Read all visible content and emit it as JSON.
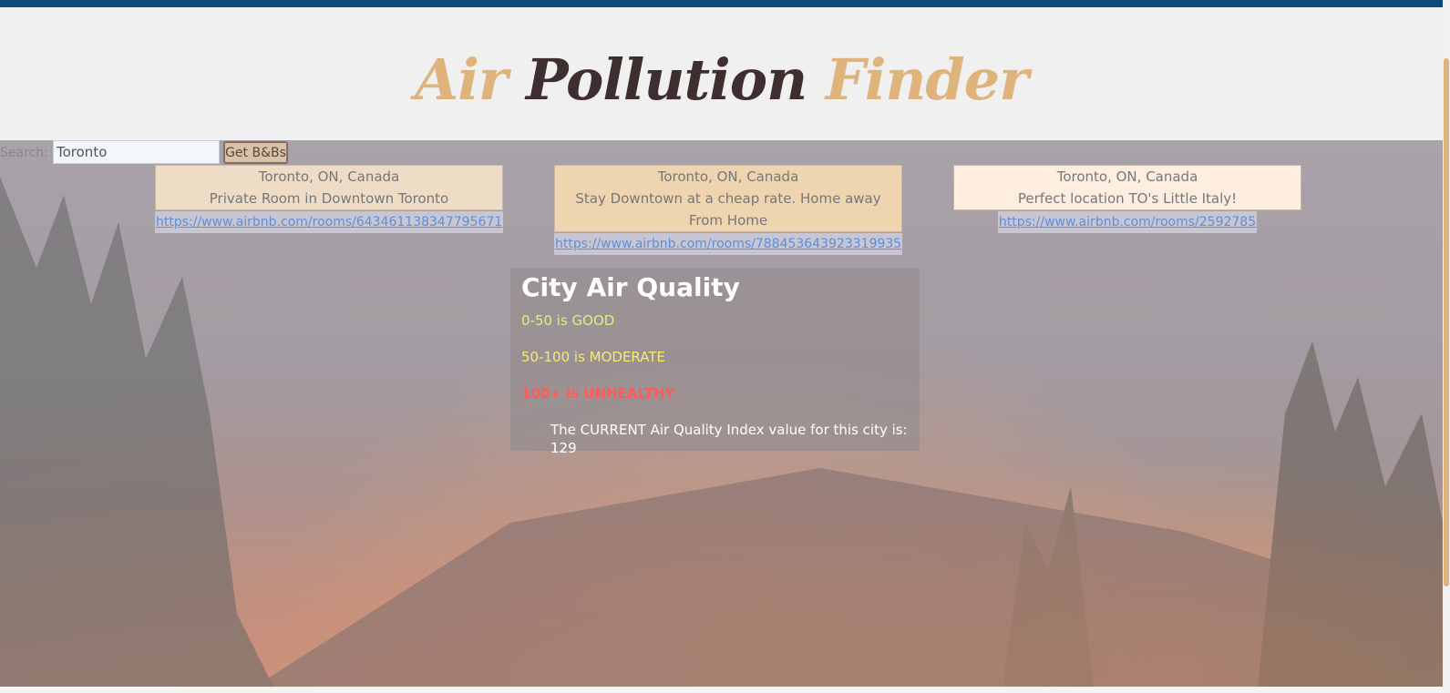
{
  "header": {
    "title_word1": "Air",
    "title_word2": "Pollution",
    "title_word3": "Finder",
    "colors": {
      "accent": "#dfb47c",
      "dark": "#3f2e2f",
      "top_bar": "#0b4a7a"
    }
  },
  "search": {
    "label": "Search:",
    "value": "Toronto",
    "button_label": "Get B&Bs"
  },
  "listings": [
    {
      "location": "Toronto, ON, Canada",
      "name": "Private Room in Downtown Toronto",
      "url": "https://www.airbnb.com/rooms/643461138347795671"
    },
    {
      "location": "Toronto, ON, Canada",
      "name": "Stay Downtown at a cheap rate. Home away From Home",
      "url": "https://www.airbnb.com/rooms/788453643923319935"
    },
    {
      "location": "Toronto, ON, Canada",
      "name": "Perfect location TO's Little Italy!",
      "url": "https://www.airbnb.com/rooms/2592785"
    }
  ],
  "air_quality": {
    "title": "City Air Quality",
    "good": "0-50 is GOOD",
    "moderate": "50-100 is MODERATE",
    "unhealthy": "100+ is UNHEALTHY",
    "current": "The CURRENT Air Quality Index value for this city is: 129",
    "colors": {
      "good": "#d8f28a",
      "moderate": "#f7ea6e",
      "unhealthy": "#ff5b5b"
    }
  },
  "background": {
    "icon": "forest-fire-photo"
  }
}
